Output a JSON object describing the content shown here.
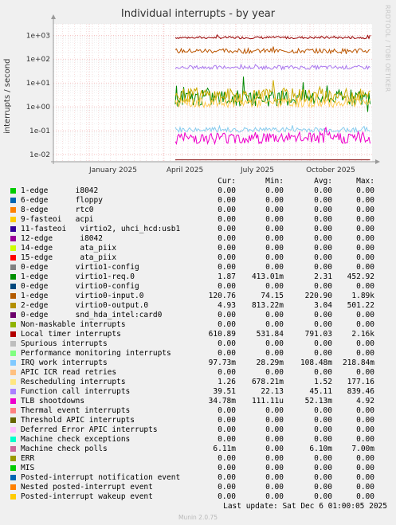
{
  "chart_data": {
    "type": "line",
    "title": "Individual interrupts - by year",
    "ylabel": "interrupts / second",
    "yscale": "log",
    "ylim": [
      0.005,
      3000
    ],
    "yticks": [
      "1e-02",
      "1e-01",
      "1e+00",
      "1e+01",
      "1e+02",
      "1e+03"
    ],
    "xticks": [
      "January 2025",
      "April 2025",
      "July 2025",
      "October 2025"
    ],
    "grid": true,
    "series_shown": [
      {
        "name": "Local timer interrupts",
        "color": "#990000",
        "level": 800,
        "noise": 0.05
      },
      {
        "name": "1-edge virtio0-input.0",
        "color": "#bb5500",
        "level": 221,
        "noise": 0.1
      },
      {
        "name": "Function call interrupts",
        "color": "#aa77ee",
        "level": 45,
        "noise": 0.08
      },
      {
        "name": "1-edge virtio1-req.0",
        "color": "#008800",
        "level": 2.3,
        "noise": 0.35
      },
      {
        "name": "2-edge virtio0-output.0",
        "color": "#ccaa00",
        "level": 3,
        "noise": 0.3
      },
      {
        "name": "Rescheduling interrupts",
        "color": "#ffcc55",
        "level": 1.5,
        "noise": 0.2
      },
      {
        "name": "IRQ work interrupts",
        "color": "#88ccee",
        "level": 0.11,
        "noise": 0.1
      },
      {
        "name": "TLB shootdowns",
        "color": "#ee00cc",
        "level": 0.05,
        "noise": 0.25
      },
      {
        "name": "Machine check polls",
        "color": "#881111",
        "level": 0.006,
        "noise": 0.0
      }
    ]
  },
  "legend": {
    "headers": {
      "cur": "Cur:",
      "min": "Min:",
      "avg": "Avg:",
      "max": "Max:"
    },
    "rows": [
      {
        "color": "#00cc00",
        "label": "1-edge      i8042",
        "cur": "0.00",
        "min": "0.00",
        "avg": "0.00",
        "max": "0.00"
      },
      {
        "color": "#0066b3",
        "label": "6-edge      floppy",
        "cur": "0.00",
        "min": "0.00",
        "avg": "0.00",
        "max": "0.00"
      },
      {
        "color": "#ff8000",
        "label": "8-edge      rtc0",
        "cur": "0.00",
        "min": "0.00",
        "avg": "0.00",
        "max": "0.00"
      },
      {
        "color": "#ffcc00",
        "label": "9-fasteoi   acpi",
        "cur": "0.00",
        "min": "0.00",
        "avg": "0.00",
        "max": "0.00"
      },
      {
        "color": "#330099",
        "label": "11-fasteoi   virtio2, uhci_hcd:usb1",
        "cur": "0.00",
        "min": "0.00",
        "avg": "0.00",
        "max": "0.00"
      },
      {
        "color": "#990099",
        "label": "12-edge      i8042",
        "cur": "0.00",
        "min": "0.00",
        "avg": "0.00",
        "max": "0.00"
      },
      {
        "color": "#ccff00",
        "label": "14-edge      ata_piix",
        "cur": "0.00",
        "min": "0.00",
        "avg": "0.00",
        "max": "0.00"
      },
      {
        "color": "#ff0000",
        "label": "15-edge      ata_piix",
        "cur": "0.00",
        "min": "0.00",
        "avg": "0.00",
        "max": "0.00"
      },
      {
        "color": "#808080",
        "label": "0-edge      virtio1-config",
        "cur": "0.00",
        "min": "0.00",
        "avg": "0.00",
        "max": "0.00"
      },
      {
        "color": "#008f00",
        "label": "1-edge      virtio1-req.0",
        "cur": "1.87",
        "min": "413.01m",
        "avg": "2.31",
        "max": "452.92"
      },
      {
        "color": "#00487d",
        "label": "0-edge      virtio0-config",
        "cur": "0.00",
        "min": "0.00",
        "avg": "0.00",
        "max": "0.00"
      },
      {
        "color": "#b35a00",
        "label": "1-edge      virtio0-input.0",
        "cur": "120.76",
        "min": "74.15",
        "avg": "220.90",
        "max": "1.89k"
      },
      {
        "color": "#b38f00",
        "label": "2-edge      virtio0-output.0",
        "cur": "4.93",
        "min": "813.22m",
        "avg": "3.04",
        "max": "501.22"
      },
      {
        "color": "#6b006b",
        "label": "0-edge      snd_hda_intel:card0",
        "cur": "0.00",
        "min": "0.00",
        "avg": "0.00",
        "max": "0.00"
      },
      {
        "color": "#8fb300",
        "label": "Non-maskable interrupts",
        "cur": "0.00",
        "min": "0.00",
        "avg": "0.00",
        "max": "0.00"
      },
      {
        "color": "#b30000",
        "label": "Local timer interrupts",
        "cur": "610.89",
        "min": "531.84",
        "avg": "791.03",
        "max": "2.16k"
      },
      {
        "color": "#bebebe",
        "label": "Spurious interrupts",
        "cur": "0.00",
        "min": "0.00",
        "avg": "0.00",
        "max": "0.00"
      },
      {
        "color": "#80ff80",
        "label": "Performance monitoring interrupts",
        "cur": "0.00",
        "min": "0.00",
        "avg": "0.00",
        "max": "0.00"
      },
      {
        "color": "#80c9ff",
        "label": "IRQ work interrupts",
        "cur": "97.73m",
        "min": "28.29m",
        "avg": "108.48m",
        "max": "218.84m"
      },
      {
        "color": "#ffc080",
        "label": "APIC ICR read retries",
        "cur": "0.00",
        "min": "0.00",
        "avg": "0.00",
        "max": "0.00"
      },
      {
        "color": "#ffe680",
        "label": "Rescheduling interrupts",
        "cur": "1.26",
        "min": "678.21m",
        "avg": "1.52",
        "max": "177.16"
      },
      {
        "color": "#aa80ff",
        "label": "Function call interrupts",
        "cur": "39.51",
        "min": "22.13",
        "avg": "45.11",
        "max": "839.46"
      },
      {
        "color": "#ee00cc",
        "label": "TLB shootdowns",
        "cur": "34.78m",
        "min": "111.11u",
        "avg": "52.13m",
        "max": "4.92"
      },
      {
        "color": "#ff8080",
        "label": "Thermal event interrupts",
        "cur": "0.00",
        "min": "0.00",
        "avg": "0.00",
        "max": "0.00"
      },
      {
        "color": "#666600",
        "label": "Threshold APIC interrupts",
        "cur": "0.00",
        "min": "0.00",
        "avg": "0.00",
        "max": "0.00"
      },
      {
        "color": "#ffbfff",
        "label": "Deferred Error APIC interrupts",
        "cur": "0.00",
        "min": "0.00",
        "avg": "0.00",
        "max": "0.00"
      },
      {
        "color": "#00ffcc",
        "label": "Machine check exceptions",
        "cur": "0.00",
        "min": "0.00",
        "avg": "0.00",
        "max": "0.00"
      },
      {
        "color": "#cc6699",
        "label": "Machine check polls",
        "cur": "6.11m",
        "min": "0.00",
        "avg": "6.10m",
        "max": "7.00m"
      },
      {
        "color": "#999900",
        "label": "ERR",
        "cur": "0.00",
        "min": "0.00",
        "avg": "0.00",
        "max": "0.00"
      },
      {
        "color": "#00cc00",
        "label": "MIS",
        "cur": "0.00",
        "min": "0.00",
        "avg": "0.00",
        "max": "0.00"
      },
      {
        "color": "#0066b3",
        "label": "Posted-interrupt notification event",
        "cur": "0.00",
        "min": "0.00",
        "avg": "0.00",
        "max": "0.00"
      },
      {
        "color": "#ff8000",
        "label": "Nested posted-interrupt event",
        "cur": "0.00",
        "min": "0.00",
        "avg": "0.00",
        "max": "0.00"
      },
      {
        "color": "#ffcc00",
        "label": "Posted-interrupt wakeup event",
        "cur": "0.00",
        "min": "0.00",
        "avg": "0.00",
        "max": "0.00"
      }
    ]
  },
  "footer": {
    "last_update": "Last update:  Sat Dec  6 01:00:05 2025",
    "munin": "Munin 2.0.75",
    "side_text": "RRDTOOL / TOBI OETIKER"
  }
}
